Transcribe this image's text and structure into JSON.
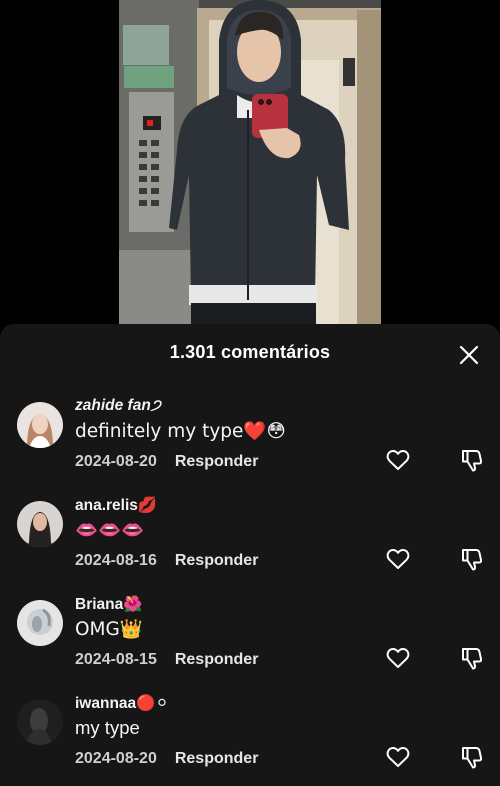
{
  "sheet": {
    "title": "1.301 comentários",
    "close_icon": "close-icon"
  },
  "comments": [
    {
      "username": "zahide fan੭",
      "text": "definitely my type❤️😳",
      "date": "2024-08-20",
      "reply": "Responder"
    },
    {
      "username": "ana.relis💋",
      "text": "👄👄👄",
      "date": "2024-08-16",
      "reply": "Responder"
    },
    {
      "username": "Briana🌺",
      "text": "OMG👑",
      "date": "2024-08-15",
      "reply": "Responder"
    },
    {
      "username": "iwannaa🔴⚪",
      "text": "my type",
      "date": "2024-08-20",
      "reply": "Responder"
    }
  ],
  "colors": {
    "background": "#000000",
    "sheet": "#161616",
    "text": "#ffffff"
  }
}
